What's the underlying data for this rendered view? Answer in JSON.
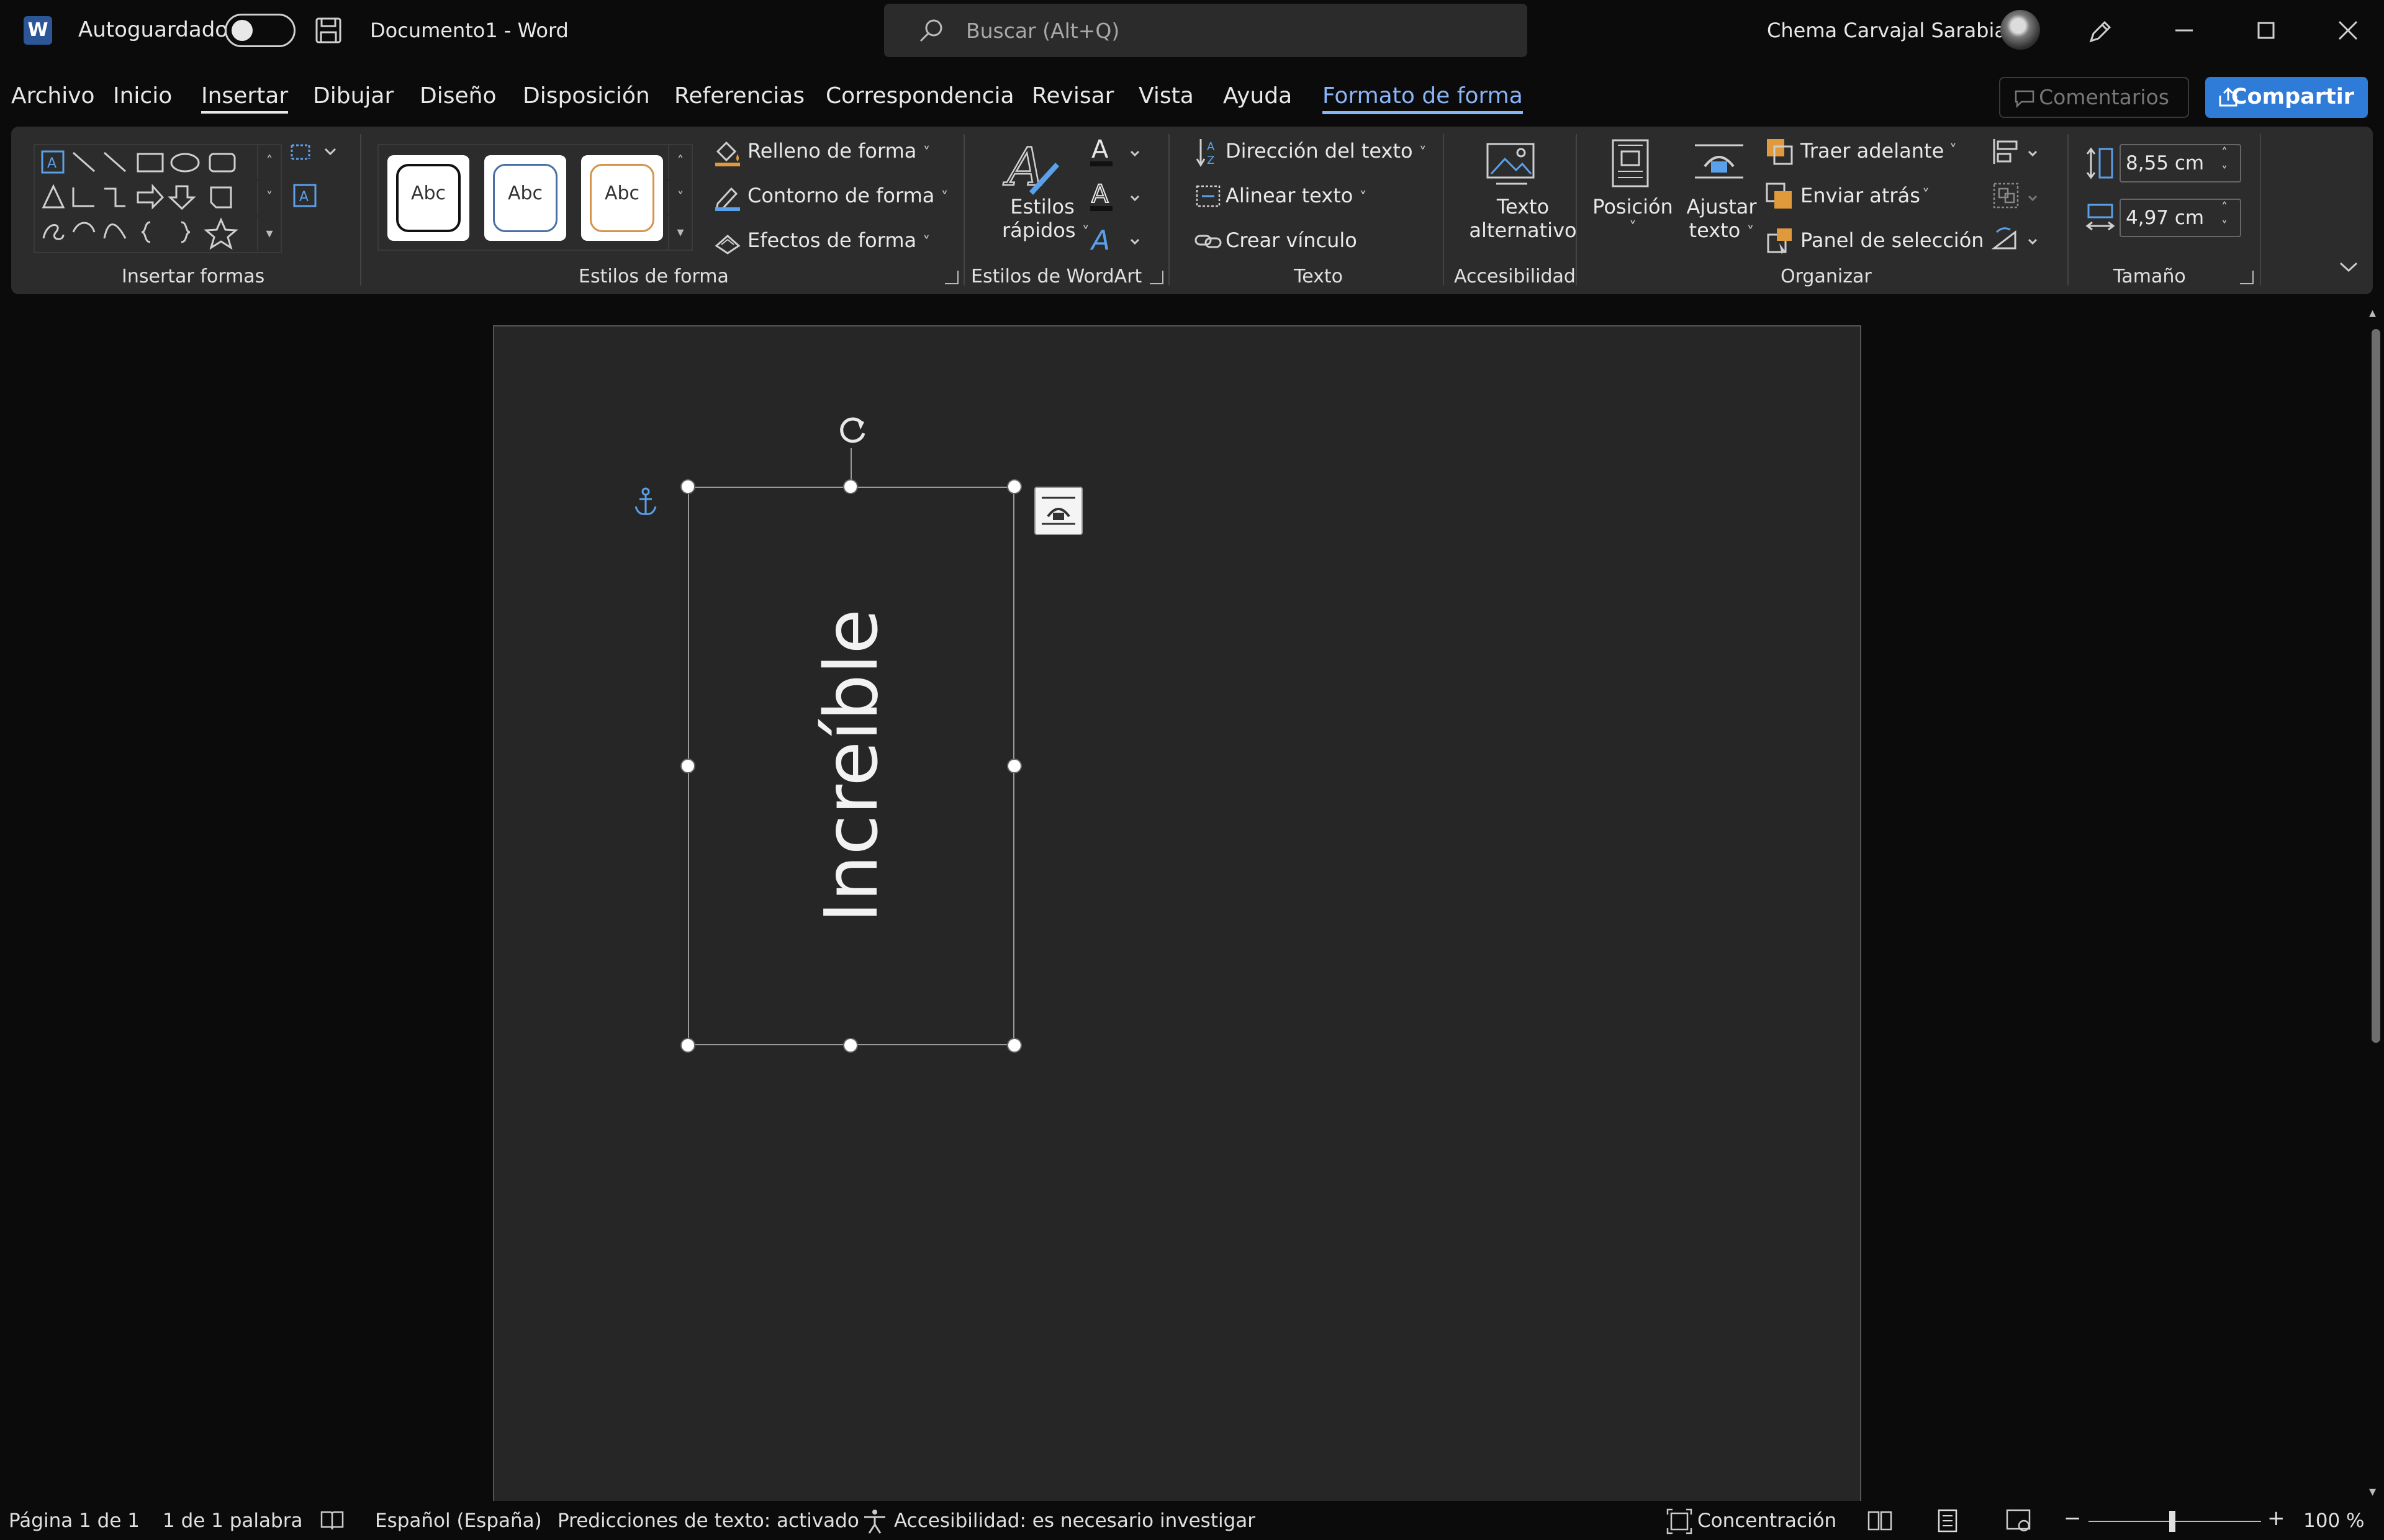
{
  "titlebar": {
    "app_logo": "W",
    "autosave_label": "Autoguardado",
    "autosave_on": false,
    "doc_title": "Documento1  -  Word",
    "search_placeholder": "Buscar (Alt+Q)",
    "user_name": "Chema Carvajal Sarabia"
  },
  "tabs": [
    {
      "label": "Archivo"
    },
    {
      "label": "Inicio"
    },
    {
      "label": "Insertar"
    },
    {
      "label": "Dibujar"
    },
    {
      "label": "Diseño"
    },
    {
      "label": "Disposición"
    },
    {
      "label": "Referencias"
    },
    {
      "label": "Correspondencia"
    },
    {
      "label": "Revisar"
    },
    {
      "label": "Vista"
    },
    {
      "label": "Ayuda"
    },
    {
      "label": "Formato de forma"
    }
  ],
  "active_tab": "Formato de forma",
  "header_buttons": {
    "comments": "Comentarios",
    "share": "Compartir"
  },
  "ribbon": {
    "insert_shapes": {
      "group_label": "Insertar formas"
    },
    "shape_styles": {
      "group_label": "Estilos de forma",
      "gallery": [
        "Abc",
        "Abc",
        "Abc"
      ],
      "fill": "Relleno de forma",
      "outline": "Contorno de forma",
      "effects": "Efectos de forma"
    },
    "wordart": {
      "group_label": "Estilos de WordArt",
      "quick_styles_line1": "Estilos",
      "quick_styles_line2": "rápidos"
    },
    "text": {
      "group_label": "Texto",
      "direction": "Dirección del texto",
      "align": "Alinear texto",
      "link": "Crear vínculo"
    },
    "accessibility": {
      "group_label": "Accesibilidad",
      "alt_text_line1": "Texto",
      "alt_text_line2": "alternativo"
    },
    "arrange": {
      "group_label": "Organizar",
      "position": "Posición",
      "wrap_line1": "Ajustar",
      "wrap_line2": "texto",
      "bring_forward": "Traer adelante",
      "send_backward": "Enviar atrás",
      "selection_pane": "Panel de selección"
    },
    "size": {
      "group_label": "Tamaño",
      "height": "8,55 cm",
      "width": "4,97 cm"
    }
  },
  "document": {
    "shape_text": "Increíble"
  },
  "statusbar": {
    "page": "Página 1 de 1",
    "words": "1 de 1 palabra",
    "language": "Español (España)",
    "predictions": "Predicciones de texto: activado",
    "accessibility": "Accesibilidad: es necesario investigar",
    "focus": "Concentración",
    "zoom": "100 %"
  },
  "colors": {
    "accent": "#8ab4f8",
    "share_button": "#2f7bd8",
    "ribbon_bg": "#2c2c2c",
    "page_bg": "#262626",
    "app_bg": "#0b0b0b"
  }
}
